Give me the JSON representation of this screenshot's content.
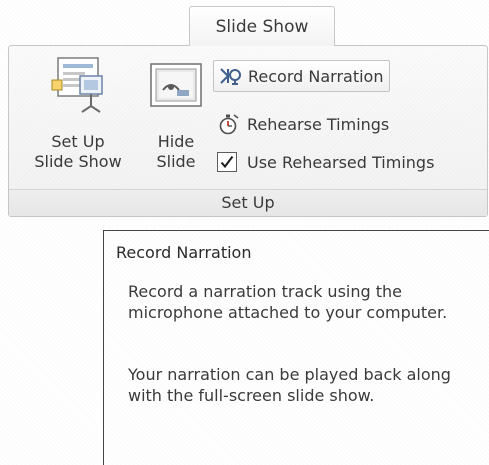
{
  "tab": {
    "label": "Slide Show"
  },
  "group": {
    "label": "Set Up",
    "buttons": {
      "setup_slide_show": {
        "line1": "Set Up",
        "line2": "Slide Show",
        "icon": "setup-slide-show-icon"
      },
      "hide_slide": {
        "line1": "Hide",
        "line2": "Slide",
        "icon": "hide-slide-icon"
      },
      "record_narration": {
        "label": "Record Narration",
        "icon": "microphone-icon"
      },
      "rehearse_timings": {
        "label": "Rehearse Timings",
        "icon": "stopwatch-icon"
      },
      "use_rehearsed_timings": {
        "label": "Use Rehearsed Timings",
        "checked": true
      }
    }
  },
  "tooltip": {
    "title": "Record Narration",
    "paragraph1": "Record a narration track using the microphone attached to your computer.",
    "paragraph2": "Your narration can be played back along with the full-screen slide show."
  },
  "colors": {
    "ribbon_border": "#c6c6c6",
    "tooltip_border": "#444444",
    "text": "#3a3a3a"
  }
}
